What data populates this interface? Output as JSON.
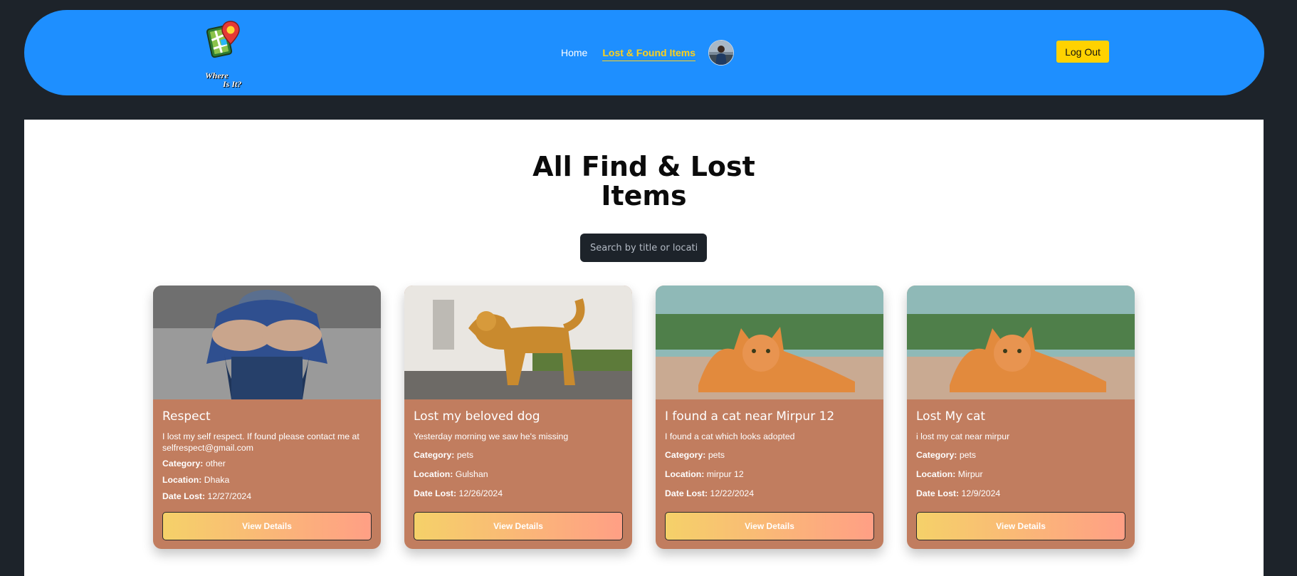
{
  "navbar": {
    "logo_line1": "Where",
    "logo_line2": "Is It?",
    "links": [
      {
        "label": "Home"
      },
      {
        "label": "Lost & Found Items"
      }
    ],
    "logout_label": "Log Out"
  },
  "main": {
    "title_line1": "All Find & Lost",
    "title_line2": "Items",
    "search_placeholder": "Search by title or location"
  },
  "cards": [
    {
      "title": "Respect",
      "description": "I lost my self respect. If found please contact me at selfrespect@gmail.com",
      "category_label": "Category:",
      "category": "other",
      "location_label": "Location:",
      "location": "Dhaka",
      "date_label": "Date Lost:",
      "date": "12/27/2024",
      "button": "View Details",
      "image_icon": "sad-boy-photo"
    },
    {
      "title": "Lost my beloved dog",
      "description": "Yesterday morning we saw he's missing",
      "category_label": "Category:",
      "category": "pets",
      "location_label": "Location:",
      "location": "Gulshan",
      "date_label": "Date Lost:",
      "date": "12/26/2024",
      "button": "View Details",
      "image_icon": "golden-retriever-photo"
    },
    {
      "title": "I found a cat near Mirpur 12",
      "description": "I found a cat which looks adopted",
      "category_label": "Category:",
      "category": "pets",
      "location_label": "Location:",
      "location": "mirpur 12",
      "date_label": "Date Lost:",
      "date": "12/22/2024",
      "button": "View Details",
      "image_icon": "orange-cat-photo"
    },
    {
      "title": "Lost My cat",
      "description": "i lost my cat near mirpur",
      "category_label": "Category:",
      "category": "pets",
      "location_label": "Location:",
      "location": "Mirpur",
      "date_label": "Date Lost:",
      "date": "12/9/2024",
      "button": "View Details",
      "image_icon": "orange-cat-photo"
    }
  ],
  "colors": {
    "page_bg": "#1d232a",
    "navbar_bg": "#1e8fff",
    "accent_yellow": "#ffd11a",
    "card_bg": "#c17d5f",
    "button_gradient_start": "#f5d169",
    "button_gradient_end": "#ff9f85"
  }
}
